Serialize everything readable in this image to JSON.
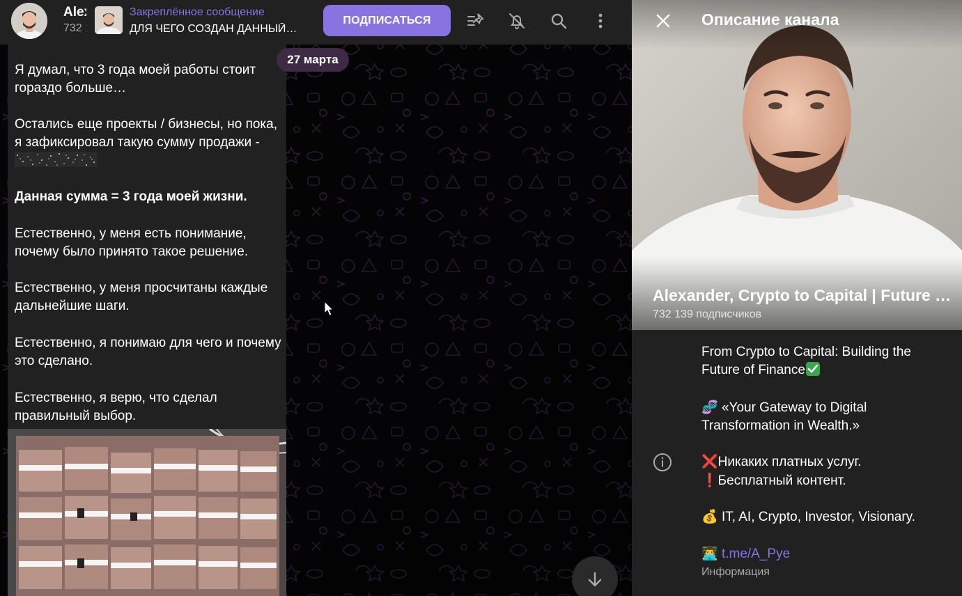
{
  "header": {
    "channel_name": "Alexander, Crypto to Capital | Future of Finance",
    "channel_sub": "732 139 подписчиков",
    "pinned_title": "Закреплённое сообщение",
    "pinned_text": "ДЛЯ ЧЕГО СОЗДАН ДАННЫЙ КАНАЛ?",
    "subscribe_label": "ПОДПИСАТЬСЯ",
    "icons": [
      "pinned-list-icon",
      "bell-off-icon",
      "search-icon",
      "more-vertical-icon"
    ]
  },
  "chat": {
    "date": "27 марта",
    "paragraphs": {
      "p1": "Я думал, что 3 года моей работы стоит гораздо больше…",
      "p2": "Остались еще проекты / бизнесы, но пока, я зафиксировал такую  сумму продажи -",
      "p3": "Данная сумма = 3 года моей жизни.",
      "p4": "Естественно, у меня есть понимание, почему было принято такое решение.",
      "p5": "Естественно, у меня просчитаны каждые дальнейшие шаги.",
      "p6": "Естественно, я понимаю для чего и почему это сделано.",
      "p7": "Естественно, я верю, что сделал правильный выбор."
    }
  },
  "panel": {
    "title": "Описание канала",
    "name": "Alexander, Crypto to Capital | Future of Finance",
    "subscribers": "732 139 подписчиков",
    "desc": {
      "line1a": "From Crypto to Capital: Building the",
      "line1b": "Future of Finance",
      "line2_emoji": "🧬",
      "line2a": " «Your Gateway to Digital",
      "line2b": "Transformation in Wealth.»",
      "line3_emoji": "❌",
      "line3": "Никаких платных услуг.",
      "line4_emoji": "❗",
      "line4": "Бесплатный контент.",
      "line5_emoji": "💰",
      "line5": " IT, AI, Crypto, Investor, Visionary.",
      "line6_emoji": "👨‍💻",
      "link": "t.me/A_Pye"
    },
    "info_label": "Информация"
  },
  "colors": {
    "accent": "#8774e1",
    "header_bg": "#212121",
    "date_pill": "#3e2a45",
    "check_green": "#3aa84a"
  }
}
